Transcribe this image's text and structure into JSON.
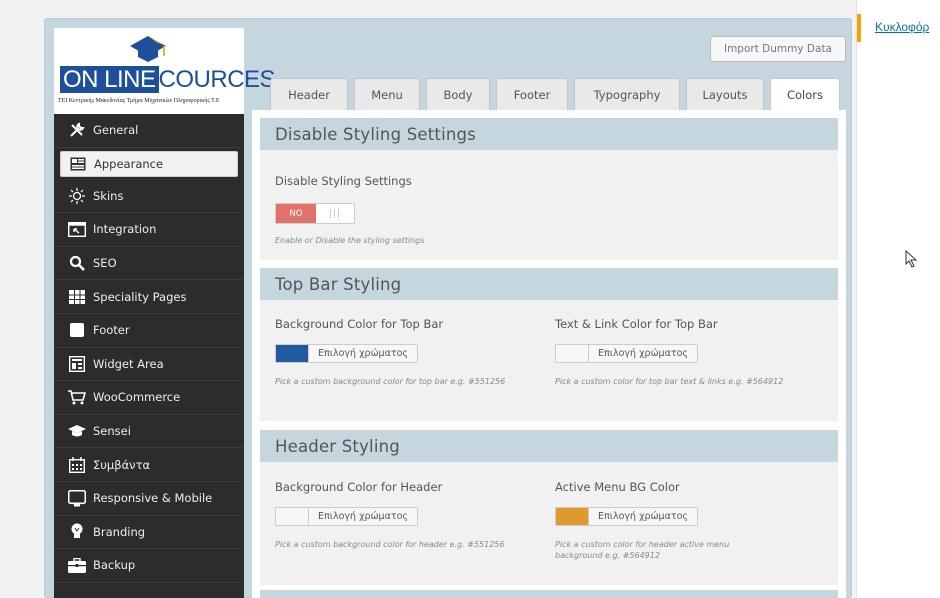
{
  "right_panel": {
    "link_text": "Κυκλοφόρ"
  },
  "logo": {
    "brand_part1": "ON LINE",
    "brand_part2": "COURCES",
    "subtitle": "ΤΕΙ Κεντρικής Μακεδονίας Τμήμα Μηχανικών Πληροφορικής Τ.Ε"
  },
  "import_button": "Import Dummy Data",
  "sidebar": {
    "items": [
      {
        "label": "General",
        "icon": "wrench-icon"
      },
      {
        "label": "Appearance",
        "icon": "layout-icon",
        "active": true
      },
      {
        "label": "Skins",
        "icon": "sun-icon"
      },
      {
        "label": "Integration",
        "icon": "window-icon"
      },
      {
        "label": "SEO",
        "icon": "search-icon"
      },
      {
        "label": "Speciality Pages",
        "icon": "grid-icon"
      },
      {
        "label": "Footer",
        "icon": "footer-icon"
      },
      {
        "label": "Widget Area",
        "icon": "widget-icon"
      },
      {
        "label": "WooCommerce",
        "icon": "cart-icon"
      },
      {
        "label": "Sensei",
        "icon": "mortarboard-icon"
      },
      {
        "label": "Συμβάντα",
        "icon": "calendar-icon"
      },
      {
        "label": "Responsive & Mobile",
        "icon": "mobile-icon"
      },
      {
        "label": "Branding",
        "icon": "bulb-icon"
      },
      {
        "label": "Backup",
        "icon": "briefcase-icon"
      }
    ]
  },
  "tabs": [
    "Header",
    "Menu",
    "Body",
    "Footer",
    "Typography",
    "Layouts",
    "Colors"
  ],
  "active_tab": "Colors",
  "sections": {
    "disable": {
      "title": "Disable Styling Settings",
      "label": "Disable Styling Settings",
      "toggle_value": "NO",
      "toggle_grip": "|||",
      "help": "Enable or Disable the styling settings"
    },
    "topbar": {
      "title": "Top Bar Styling",
      "bg_label": "Background Color for Top Bar",
      "bg_button": "Επιλογή χρώματος",
      "bg_color": "#1f5b9e",
      "bg_help": "Pick a custom background color for top bar e.g. #551256",
      "text_label": "Text & Link Color for Top Bar",
      "text_button": "Επιλογή χρώματος",
      "text_color": "#f7f7f7",
      "text_help": "Pick a custom color for top bar text & links e.g. #564912"
    },
    "header": {
      "title": "Header Styling",
      "bg_label": "Background Color for Header",
      "bg_button": "Επιλογή χρώματος",
      "bg_color": "#f7f7f7",
      "bg_help": "Pick a custom background color for header e.g. #551256",
      "active_label": "Active Menu BG Color",
      "active_button": "Επιλογή χρώματος",
      "active_color": "#e0992e",
      "active_help": "Pick a custom color for header active menu background e.g. #564912"
    }
  }
}
